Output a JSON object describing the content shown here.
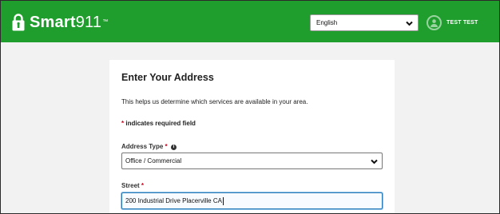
{
  "header": {
    "brand_bold": "Smart",
    "brand_num": "911",
    "brand_tm": "™",
    "language": "English",
    "user_name": "TEST TEST"
  },
  "form": {
    "title": "Enter Your Address",
    "description": "This helps us determine which services are available in your area.",
    "required_note": "indicates required field",
    "required_mark": "*",
    "address_type_label": "Address Type",
    "address_type_value": "Office / Commercial",
    "street_label": "Street",
    "street_value": "200 Industrial Drive Placerville CA"
  },
  "icons": {
    "logo": "lock-icon",
    "language_dropdown": "chevron-down-icon",
    "user": "user-avatar-icon",
    "info": "info-icon"
  },
  "colors": {
    "header_green": "#1f9e2e",
    "required_red": "#d0021b",
    "focus_blue": "#2b7bb9"
  }
}
